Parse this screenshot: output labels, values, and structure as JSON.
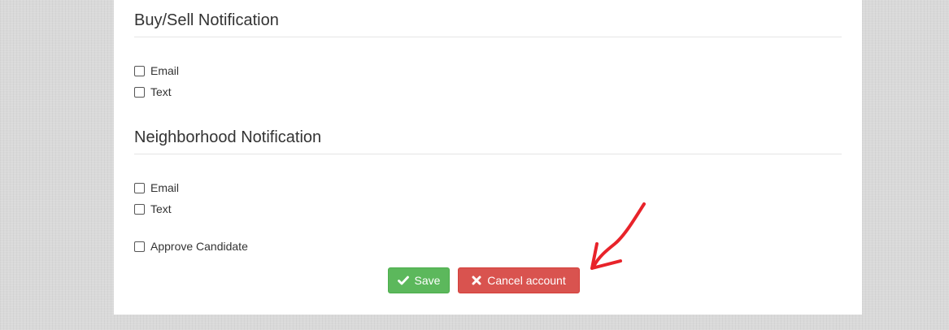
{
  "sections": [
    {
      "title": "Buy/Sell Notification",
      "options": [
        {
          "label": "Email",
          "checked": false
        },
        {
          "label": "Text",
          "checked": false
        }
      ]
    },
    {
      "title": "Neighborhood Notification",
      "options": [
        {
          "label": "Email",
          "checked": false
        },
        {
          "label": "Text",
          "checked": false
        }
      ]
    }
  ],
  "approve": {
    "label": "Approve Candidate",
    "checked": false
  },
  "buttons": {
    "save_label": "Save",
    "cancel_label": "Cancel account"
  },
  "icons": {
    "save": "check-icon",
    "cancel": "times-icon",
    "annotation": "red-arrow-icon"
  },
  "colors": {
    "save": "#5cb85c",
    "cancel": "#d9534f",
    "annotation": "#e8232a"
  }
}
